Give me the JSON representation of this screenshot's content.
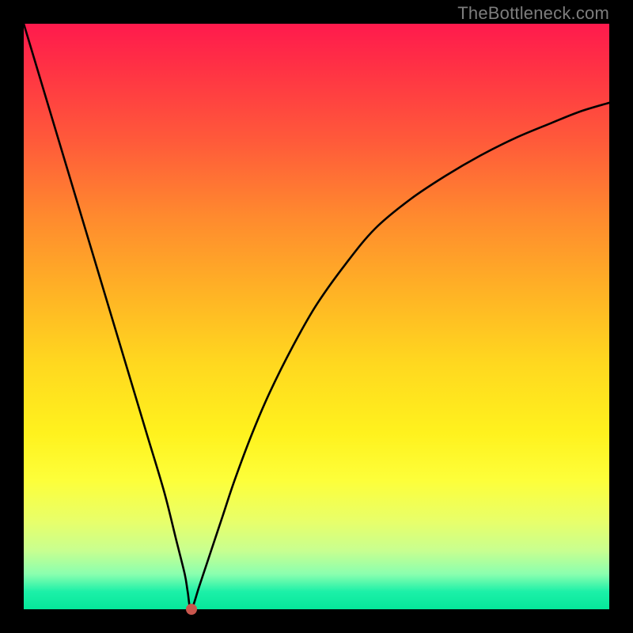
{
  "watermark": "TheBottleneck.com",
  "colors": {
    "background": "#000000",
    "gradient_top": "#ff1a4d",
    "gradient_bottom": "#05e89a",
    "curve": "#000000",
    "marker": "#c9564d"
  },
  "chart_data": {
    "type": "line",
    "title": "",
    "xlabel": "",
    "ylabel": "",
    "xlim": [
      0,
      100
    ],
    "ylim": [
      0,
      100
    ],
    "grid": false,
    "legend": false,
    "marker": {
      "x": 28.6,
      "y": 0
    },
    "series": [
      {
        "name": "curve",
        "x": [
          0,
          3,
          6,
          9,
          12,
          15,
          18,
          21,
          24,
          26,
          27.5,
          28,
          28.6,
          30,
          32,
          34,
          36,
          39,
          42,
          46,
          50,
          55,
          60,
          66,
          72,
          78,
          84,
          90,
          95,
          100
        ],
        "values": [
          100,
          90,
          80,
          70,
          60,
          50,
          40,
          30,
          20,
          12,
          6,
          3,
          0,
          4,
          10,
          16,
          22,
          30,
          37,
          45,
          52,
          59,
          65,
          70,
          74,
          77.5,
          80.5,
          83,
          85,
          86.5
        ]
      }
    ]
  }
}
